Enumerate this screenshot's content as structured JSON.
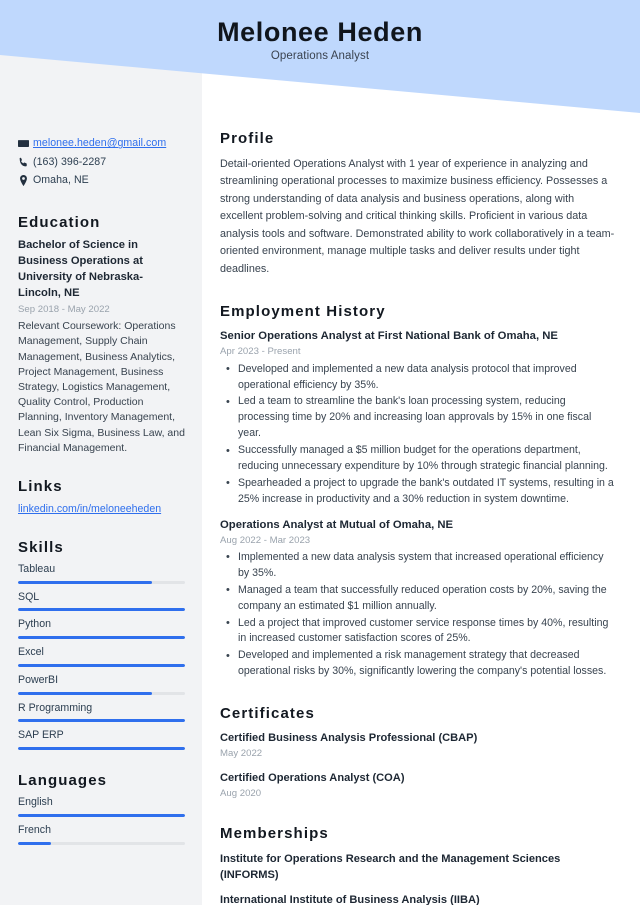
{
  "header": {
    "name": "Melonee Heden",
    "role": "Operations Analyst",
    "banner_color": "#bfd8fd"
  },
  "sidebar": {
    "background_color": "#f2f3f5",
    "accent_color": "#2f6fed",
    "contact": [
      {
        "icon": "envelope-icon",
        "text": "melonee.heden@gmail.com",
        "is_link": true
      },
      {
        "icon": "phone-icon",
        "text": "(163) 396-2287",
        "is_link": false
      },
      {
        "icon": "location-pin-icon",
        "text": "Omaha, NE",
        "is_link": false
      }
    ],
    "education": {
      "heading": "Education",
      "degree": "Bachelor of Science in Business Operations at University of Nebraska-Lincoln, NE",
      "date": "Sep 2018 - May 2022",
      "description": "Relevant Coursework: Operations Management, Supply Chain Management, Business Analytics, Project Management, Business Strategy, Logistics Management, Quality Control, Production Planning, Inventory Management, Lean Six Sigma, Business Law, and Financial Management."
    },
    "links": {
      "heading": "Links",
      "items": [
        {
          "label": "linkedin.com/in/meloneeheden"
        }
      ]
    },
    "skills": {
      "heading": "Skills",
      "items": [
        {
          "label": "Tableau",
          "level": 80
        },
        {
          "label": "SQL",
          "level": 100
        },
        {
          "label": "Python",
          "level": 100
        },
        {
          "label": "Excel",
          "level": 100
        },
        {
          "label": "PowerBI",
          "level": 80
        },
        {
          "label": "R Programming",
          "level": 100
        },
        {
          "label": "SAP ERP",
          "level": 100
        }
      ]
    },
    "languages": {
      "heading": "Languages",
      "items": [
        {
          "label": "English",
          "level": 100
        },
        {
          "label": "French",
          "level": 20
        }
      ]
    }
  },
  "main": {
    "profile": {
      "heading": "Profile",
      "text": "Detail-oriented Operations Analyst with 1 year of experience in analyzing and streamlining operational processes to maximize business efficiency. Possesses a strong understanding of data analysis and business operations, along with excellent problem-solving and critical thinking skills. Proficient in various data analysis tools and software. Demonstrated ability to work collaboratively in a team-oriented environment, manage multiple tasks and deliver results under tight deadlines."
    },
    "employment": {
      "heading": "Employment History",
      "jobs": [
        {
          "title": "Senior Operations Analyst at First National Bank of Omaha, NE",
          "date": "Apr 2023 - Present",
          "bullets": [
            "Developed and implemented a new data analysis protocol that improved operational efficiency by 35%.",
            "Led a team to streamline the bank's loan processing system, reducing processing time by 20% and increasing loan approvals by 15% in one fiscal year.",
            "Successfully managed a $5 million budget for the operations department, reducing unnecessary expenditure by 10% through strategic financial planning.",
            "Spearheaded a project to upgrade the bank's outdated IT systems, resulting in a 25% increase in productivity and a 30% reduction in system downtime."
          ]
        },
        {
          "title": "Operations Analyst at Mutual of Omaha, NE",
          "date": "Aug 2022 - Mar 2023",
          "bullets": [
            "Implemented a new data analysis system that increased operational efficiency by 35%.",
            "Managed a team that successfully reduced operation costs by 20%, saving the company an estimated $1 million annually.",
            "Led a project that improved customer service response times by 40%, resulting in increased customer satisfaction scores of 25%.",
            "Developed and implemented a risk management strategy that decreased operational risks by 30%, significantly lowering the company's potential losses."
          ]
        }
      ]
    },
    "certificates": {
      "heading": "Certificates",
      "items": [
        {
          "name": "Certified Business Analysis Professional (CBAP)",
          "date": "May 2022"
        },
        {
          "name": "Certified Operations Analyst (COA)",
          "date": "Aug 2020"
        }
      ]
    },
    "memberships": {
      "heading": "Memberships",
      "items": [
        {
          "name": "Institute for Operations Research and the Management Sciences (INFORMS)"
        },
        {
          "name": "International Institute of Business Analysis (IIBA)"
        }
      ]
    }
  }
}
